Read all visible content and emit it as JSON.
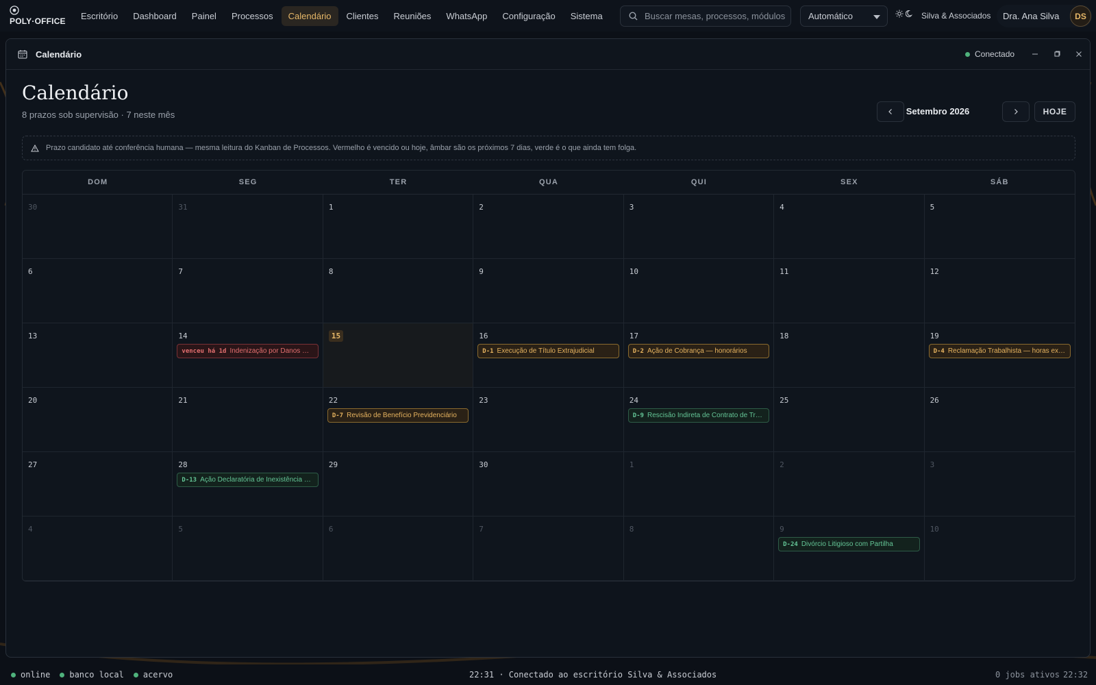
{
  "brand": {
    "name": "POLY·OFFICE"
  },
  "nav": [
    {
      "label": "Escritório",
      "active": false
    },
    {
      "label": "Dashboard",
      "active": false
    },
    {
      "label": "Painel",
      "active": false
    },
    {
      "label": "Processos",
      "active": false
    },
    {
      "label": "Calendário",
      "active": true
    },
    {
      "label": "Clientes",
      "active": false
    },
    {
      "label": "Reuniões",
      "active": false
    },
    {
      "label": "WhatsApp",
      "active": false
    },
    {
      "label": "Configuração",
      "active": false
    },
    {
      "label": "Sistema",
      "active": false
    }
  ],
  "search": {
    "placeholder": "Buscar mesas, processos, módulos"
  },
  "mode_select": {
    "value": "Automático"
  },
  "firm_name": "Silva & Associados",
  "user": {
    "name": "Dra. Ana Silva",
    "initials": "DS"
  },
  "window": {
    "title": "Calendário",
    "status": "Conectado",
    "icon": "calendar-icon"
  },
  "page": {
    "title": "Calendário",
    "subtitle": "8 prazos sob supervisão · 7 neste mês",
    "month_label": "Setembro 2026",
    "today_button": "HOJE"
  },
  "banner": {
    "icon": "warning-icon",
    "text": "Prazo candidato até conferência humana — mesma leitura do Kanban de Processos. Vermelho é vencido ou hoje, âmbar são os próximos 7 dias, verde é o que ainda tem folga."
  },
  "weekdays": [
    "DOM",
    "SEG",
    "TER",
    "QUA",
    "QUI",
    "SEX",
    "SÁB"
  ],
  "days": [
    {
      "n": "30",
      "muted": true
    },
    {
      "n": "31",
      "muted": true
    },
    {
      "n": "1"
    },
    {
      "n": "2"
    },
    {
      "n": "3"
    },
    {
      "n": "4"
    },
    {
      "n": "5"
    },
    {
      "n": "6"
    },
    {
      "n": "7"
    },
    {
      "n": "8"
    },
    {
      "n": "9"
    },
    {
      "n": "10"
    },
    {
      "n": "11"
    },
    {
      "n": "12"
    },
    {
      "n": "13"
    },
    {
      "n": "14",
      "event": {
        "tag": "venceu há 1d",
        "title": "Indenização por Danos Morais",
        "color": "red"
      }
    },
    {
      "n": "15",
      "today": true
    },
    {
      "n": "16",
      "event": {
        "tag": "D-1",
        "title": "Execução de Título Extrajudicial",
        "color": "amber"
      }
    },
    {
      "n": "17",
      "event": {
        "tag": "D-2",
        "title": "Ação de Cobrança — honorários",
        "color": "amber"
      }
    },
    {
      "n": "18"
    },
    {
      "n": "19",
      "event": {
        "tag": "D-4",
        "title": "Reclamação Trabalhista — horas extras",
        "color": "amber"
      }
    },
    {
      "n": "20"
    },
    {
      "n": "21"
    },
    {
      "n": "22",
      "event": {
        "tag": "D-7",
        "title": "Revisão de Benefício Previdenciário",
        "color": "amber"
      }
    },
    {
      "n": "23"
    },
    {
      "n": "24",
      "event": {
        "tag": "D-9",
        "title": "Rescisão Indireta de Contrato de Trabalho",
        "color": "green"
      }
    },
    {
      "n": "25"
    },
    {
      "n": "26"
    },
    {
      "n": "27"
    },
    {
      "n": "28",
      "event": {
        "tag": "D-13",
        "title": "Ação Declaratória de Inexistência de Débito",
        "color": "green"
      }
    },
    {
      "n": "29"
    },
    {
      "n": "30"
    },
    {
      "n": "1",
      "muted": true
    },
    {
      "n": "2",
      "muted": true
    },
    {
      "n": "3",
      "muted": true
    },
    {
      "n": "4",
      "muted": true
    },
    {
      "n": "5",
      "muted": true
    },
    {
      "n": "6",
      "muted": true
    },
    {
      "n": "7",
      "muted": true
    },
    {
      "n": "8",
      "muted": true
    },
    {
      "n": "9",
      "muted": true,
      "event": {
        "tag": "D-24",
        "title": "Divórcio Litigioso com Partilha",
        "color": "green"
      }
    },
    {
      "n": "10",
      "muted": true
    }
  ],
  "footer": {
    "indicators": [
      "online",
      "banco local",
      "acervo"
    ],
    "message": "22:31 · Conectado ao escritório Silva & Associados",
    "jobs": "0 jobs ativos",
    "time": "22:32"
  },
  "colors": {
    "accent": "#e6b768",
    "overdue": "#e36f6f",
    "upcoming": "#e6b35f",
    "slack": "#64c596",
    "online": "#4fb27c"
  }
}
